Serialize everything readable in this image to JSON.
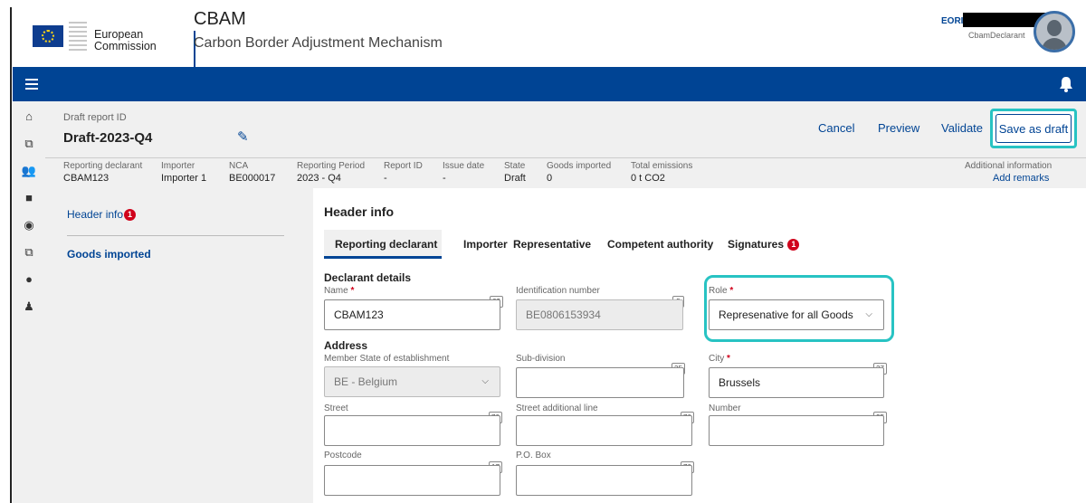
{
  "header": {
    "brand_line1": "European",
    "brand_line2": "Commission",
    "app_name": "CBAM",
    "app_subtitle": "Carbon Border Adjustment Mechanism",
    "eori_label": "EORI",
    "user_role": "CbamDeclarant"
  },
  "report": {
    "id_label": "Draft report ID",
    "id_value": "Draft-2023-Q4",
    "actions": {
      "cancel": "Cancel",
      "preview": "Preview",
      "validate": "Validate",
      "save_draft": "Save as draft"
    },
    "meta": [
      {
        "label": "Reporting declarant",
        "value": "CBAM123"
      },
      {
        "label": "Importer",
        "value": "Importer 1"
      },
      {
        "label": "NCA",
        "value": "BE000017"
      },
      {
        "label": "Reporting Period",
        "value": "2023 - Q4"
      },
      {
        "label": "Report ID",
        "value": "-"
      },
      {
        "label": "Issue date",
        "value": "-"
      },
      {
        "label": "State",
        "value": "Draft"
      },
      {
        "label": "Goods imported",
        "value": "0"
      },
      {
        "label": "Total emissions",
        "value": "0 t CO2"
      }
    ],
    "additional_info_label": "Additional information",
    "add_remarks": "Add remarks"
  },
  "leftnav": {
    "header_info": "Header info",
    "header_info_badge": "1",
    "goods_imported": "Goods imported"
  },
  "main": {
    "section_title": "Header info",
    "tabs": [
      {
        "label": "Reporting declarant"
      },
      {
        "label": "Importer"
      },
      {
        "label": "Representative"
      },
      {
        "label": "Competent authority"
      },
      {
        "label": "Signatures"
      }
    ],
    "signatures_badge": "1",
    "declarant_details": "Declarant details",
    "name": {
      "label": "Name",
      "value": "CBAM123",
      "counter": "63"
    },
    "identification": {
      "label": "Identification number",
      "value": "BE0806153934",
      "counter": "5"
    },
    "role": {
      "label": "Role",
      "value": "Represenative for all Goods"
    },
    "address": "Address",
    "member_state": {
      "label": "Member State of establishment",
      "value": "BE - Belgium"
    },
    "subdivision": {
      "label": "Sub-division",
      "value": "",
      "counter": "35"
    },
    "city": {
      "label": "City",
      "value": "Brussels",
      "counter": "27"
    },
    "street": {
      "label": "Street",
      "value": "",
      "counter": "70"
    },
    "street_additional": {
      "label": "Street additional line",
      "value": "",
      "counter": "70"
    },
    "number": {
      "label": "Number",
      "value": "",
      "counter": "35"
    },
    "postcode": {
      "label": "Postcode",
      "value": "",
      "counter": "17"
    },
    "po_box": {
      "label": "P.O. Box",
      "value": "",
      "counter": "70"
    },
    "required_mark": "*"
  },
  "colors": {
    "brand_blue": "#004494",
    "highlight": "#28c3c3",
    "badge_red": "#d0021b"
  }
}
